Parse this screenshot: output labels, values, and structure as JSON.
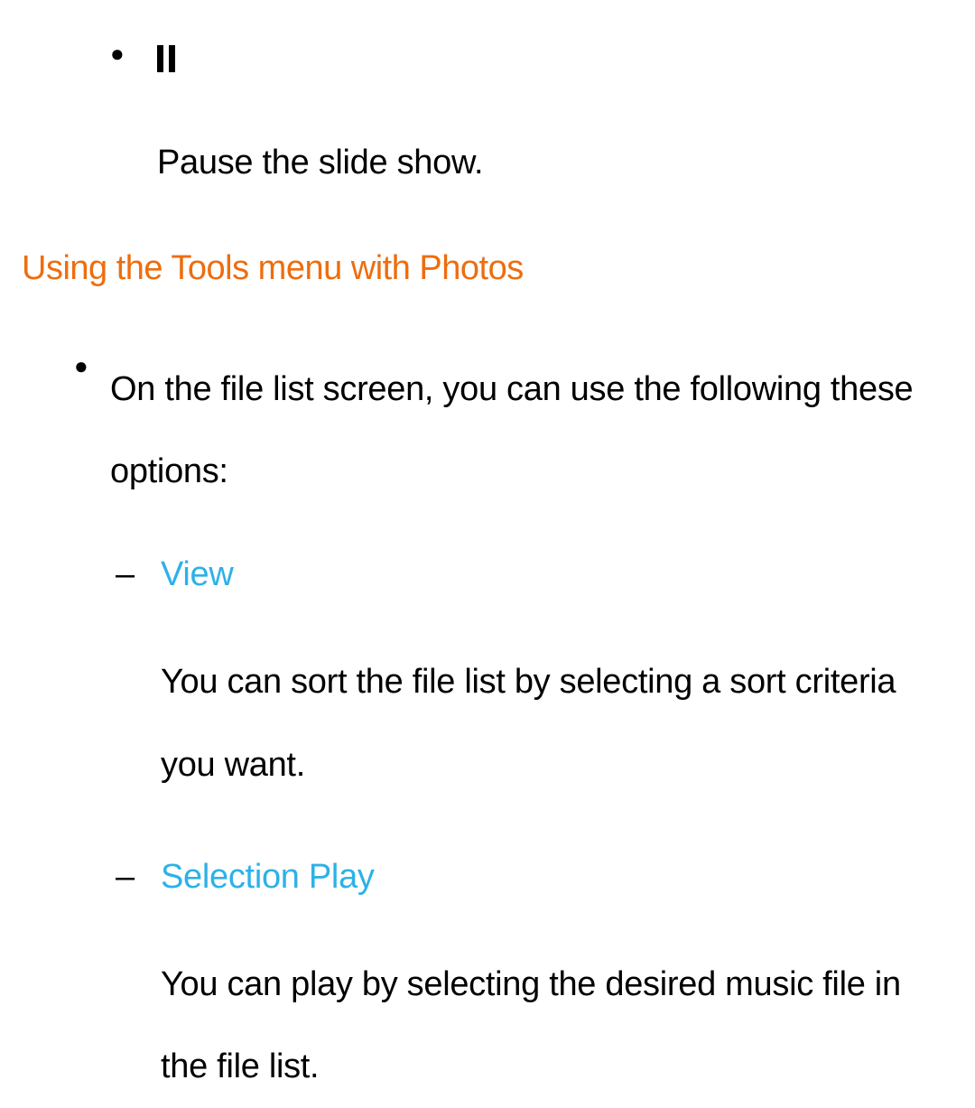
{
  "pause_section": {
    "icon_name": "pause-icon",
    "description": "Pause the slide show."
  },
  "heading": "Using the Tools menu with Photos",
  "intro": "On the file list screen, you can use the following these options:",
  "options": [
    {
      "title": "View",
      "description": "You can sort the file list by selecting a sort criteria you want."
    },
    {
      "title": "Selection Play",
      "description": "You can play by selecting the desired music file in the file list."
    }
  ]
}
